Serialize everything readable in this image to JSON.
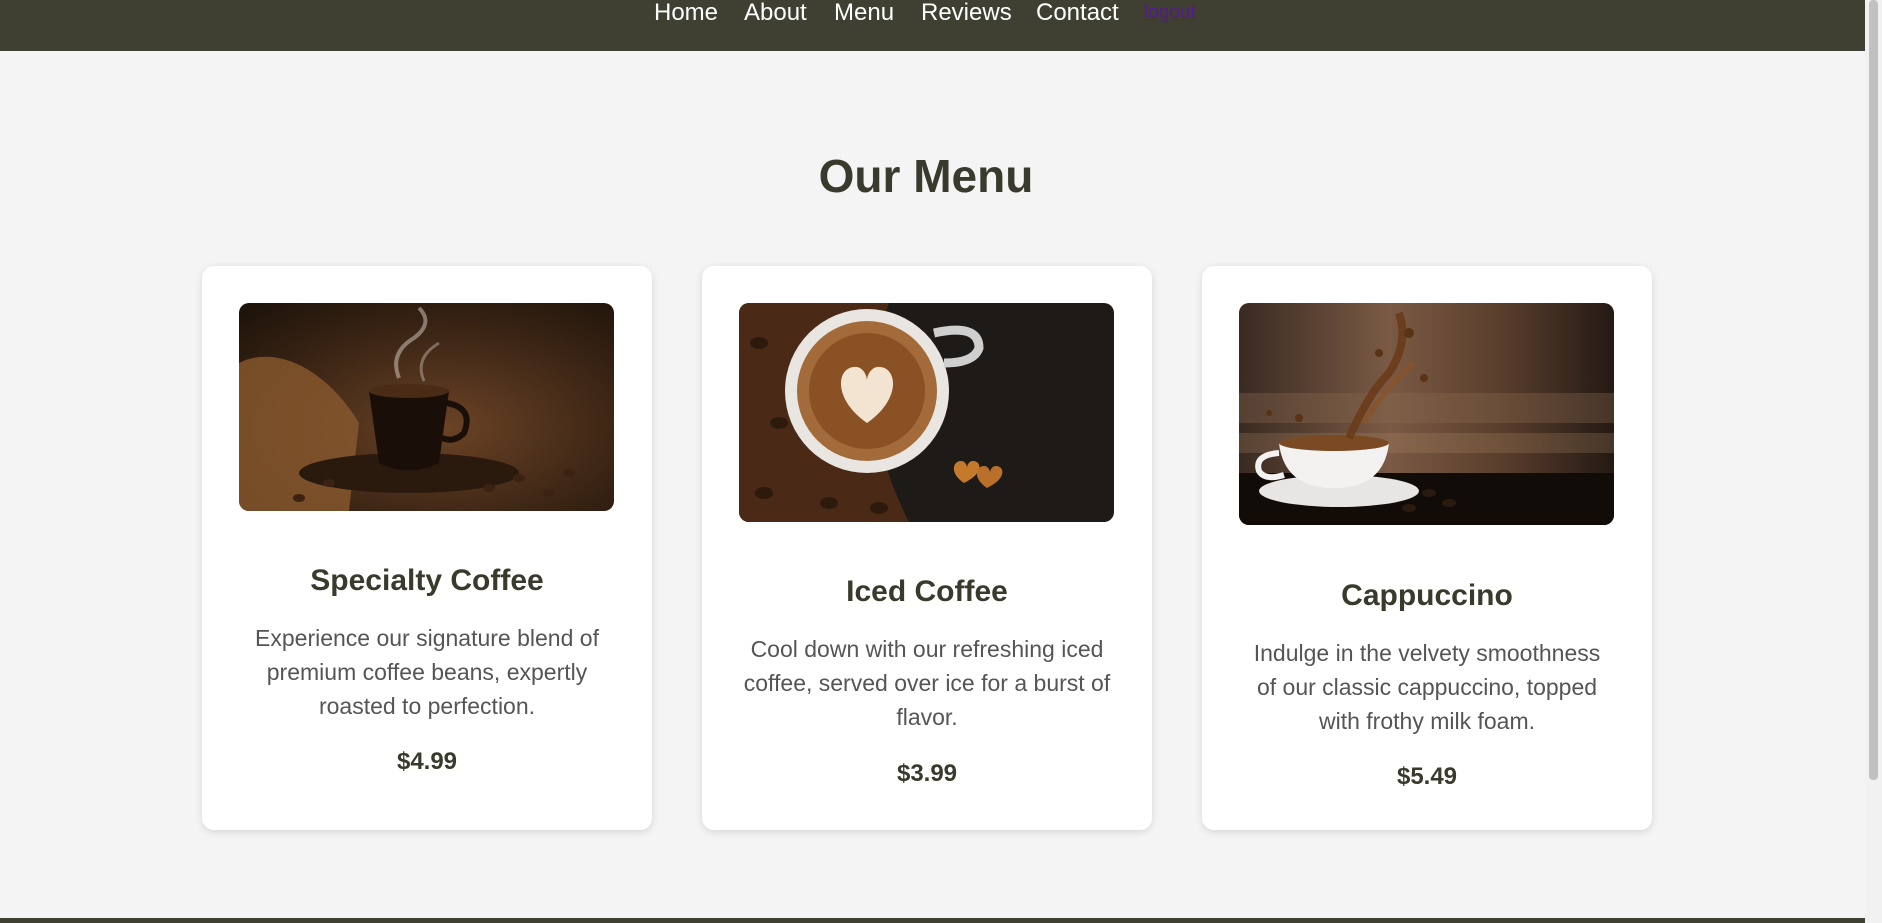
{
  "nav": {
    "home": "Home",
    "about": "About",
    "menu": "Menu",
    "reviews": "Reviews",
    "contact": "Contact",
    "logout": "logout"
  },
  "colors": {
    "nav_bg": "#3f4032",
    "page_bg": "#f4f4f4",
    "heading": "#3a3a2c",
    "body_text": "#555555",
    "visited_link": "#551a8b"
  },
  "menu": {
    "title": "Our Menu",
    "items": [
      {
        "name": "Specialty Coffee",
        "description": "Experience our signature blend of premium coffee beans, expertly roasted to perfection.",
        "price": "$4.99",
        "image": "steaming-coffee-cup-photo"
      },
      {
        "name": "Iced Coffee",
        "description": "Cool down with our refreshing iced coffee, served over ice for a burst of flavor.",
        "price": "$3.99",
        "image": "latte-art-heart-photo"
      },
      {
        "name": "Cappuccino",
        "description": "Indulge in the velvety smoothness of our classic cappuccino, topped with frothy milk foam.",
        "price": "$5.49",
        "image": "coffee-splash-cup-photo"
      }
    ]
  }
}
